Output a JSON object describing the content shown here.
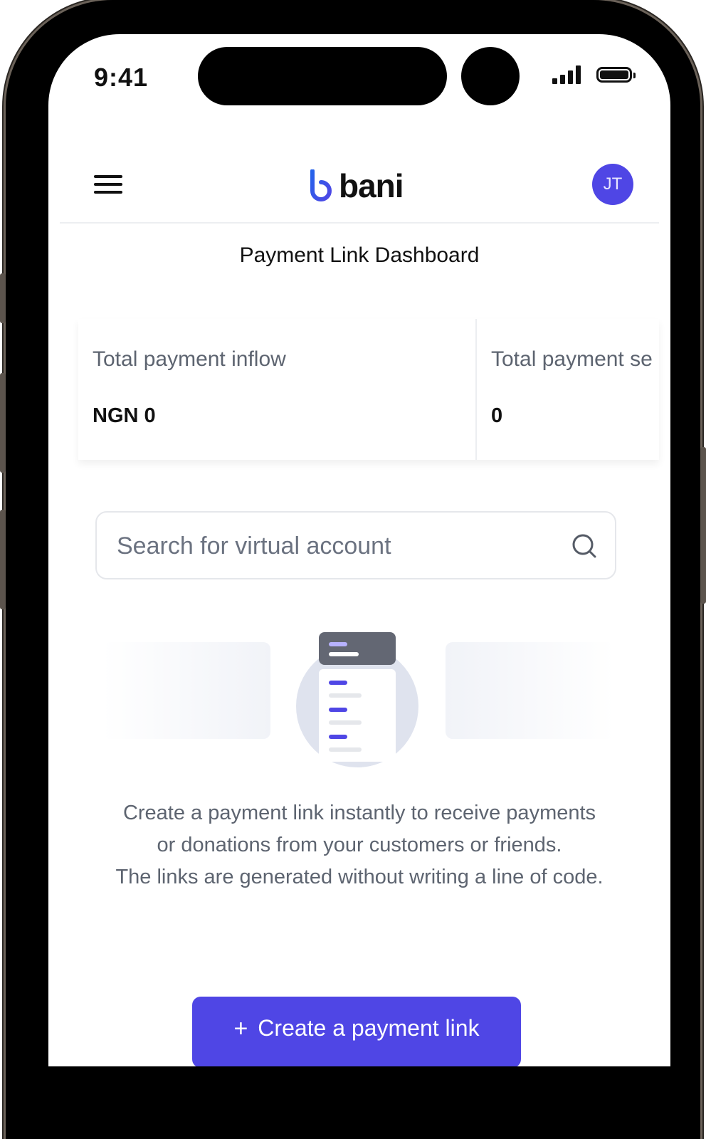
{
  "status_bar": {
    "time": "9:41"
  },
  "header": {
    "brand": "bani",
    "avatar_initials": "JT",
    "accent_color": "#4f46e5",
    "menu_icon": "hamburger-menu-icon"
  },
  "page": {
    "title": "Payment Link Dashboard"
  },
  "stats": [
    {
      "label": "Total payment inflow",
      "value": "NGN 0"
    },
    {
      "label": "Total payment se",
      "value": "0"
    }
  ],
  "search": {
    "placeholder": "Search for virtual account",
    "icon": "search-icon"
  },
  "empty_state": {
    "lines": [
      "Create a payment link instantly to receive payments or donations from your customers or friends.",
      "The links are generated without writing a line of code."
    ]
  },
  "cta": {
    "label": "Create a payment link",
    "icon": "plus-icon"
  }
}
